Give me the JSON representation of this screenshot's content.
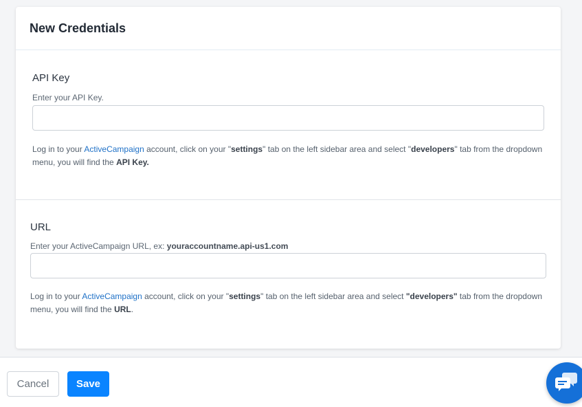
{
  "header": {
    "title": "New Credentials"
  },
  "api_key": {
    "label": "API Key",
    "hint": "Enter your API Key.",
    "value": "",
    "placeholder": "",
    "help": {
      "prefix": "Log in to your ",
      "link": "ActiveCampaign",
      "middle1": " account, click on your \"",
      "settings": "settings",
      "middle2": "\" tab on the left sidebar area and select \"",
      "developers": "developers",
      "middle3": "\" tab from the dropdown menu, you will find the ",
      "target": "API Key."
    }
  },
  "url": {
    "label": "URL",
    "hint_prefix": "Enter your ActiveCampaign URL, ex: ",
    "hint_example": "youraccountname.api-us1.com",
    "value": "",
    "placeholder": "",
    "help": {
      "prefix": "Log in to your ",
      "link": "ActiveCampaign",
      "middle1": " account, click on your \"",
      "settings": "settings",
      "middle2": "\" tab on the left sidebar area and select ",
      "developers": "\"developers\"",
      "middle3": " tab from the dropdown menu, you will find the ",
      "target": "URL",
      "suffix": "."
    }
  },
  "footer": {
    "cancel_label": "Cancel",
    "save_label": "Save"
  },
  "chat": {
    "icon": "chat-bubbles-icon"
  },
  "colors": {
    "primary": "#0a84ff",
    "link": "#1f71c7",
    "chat": "#1570d8"
  }
}
